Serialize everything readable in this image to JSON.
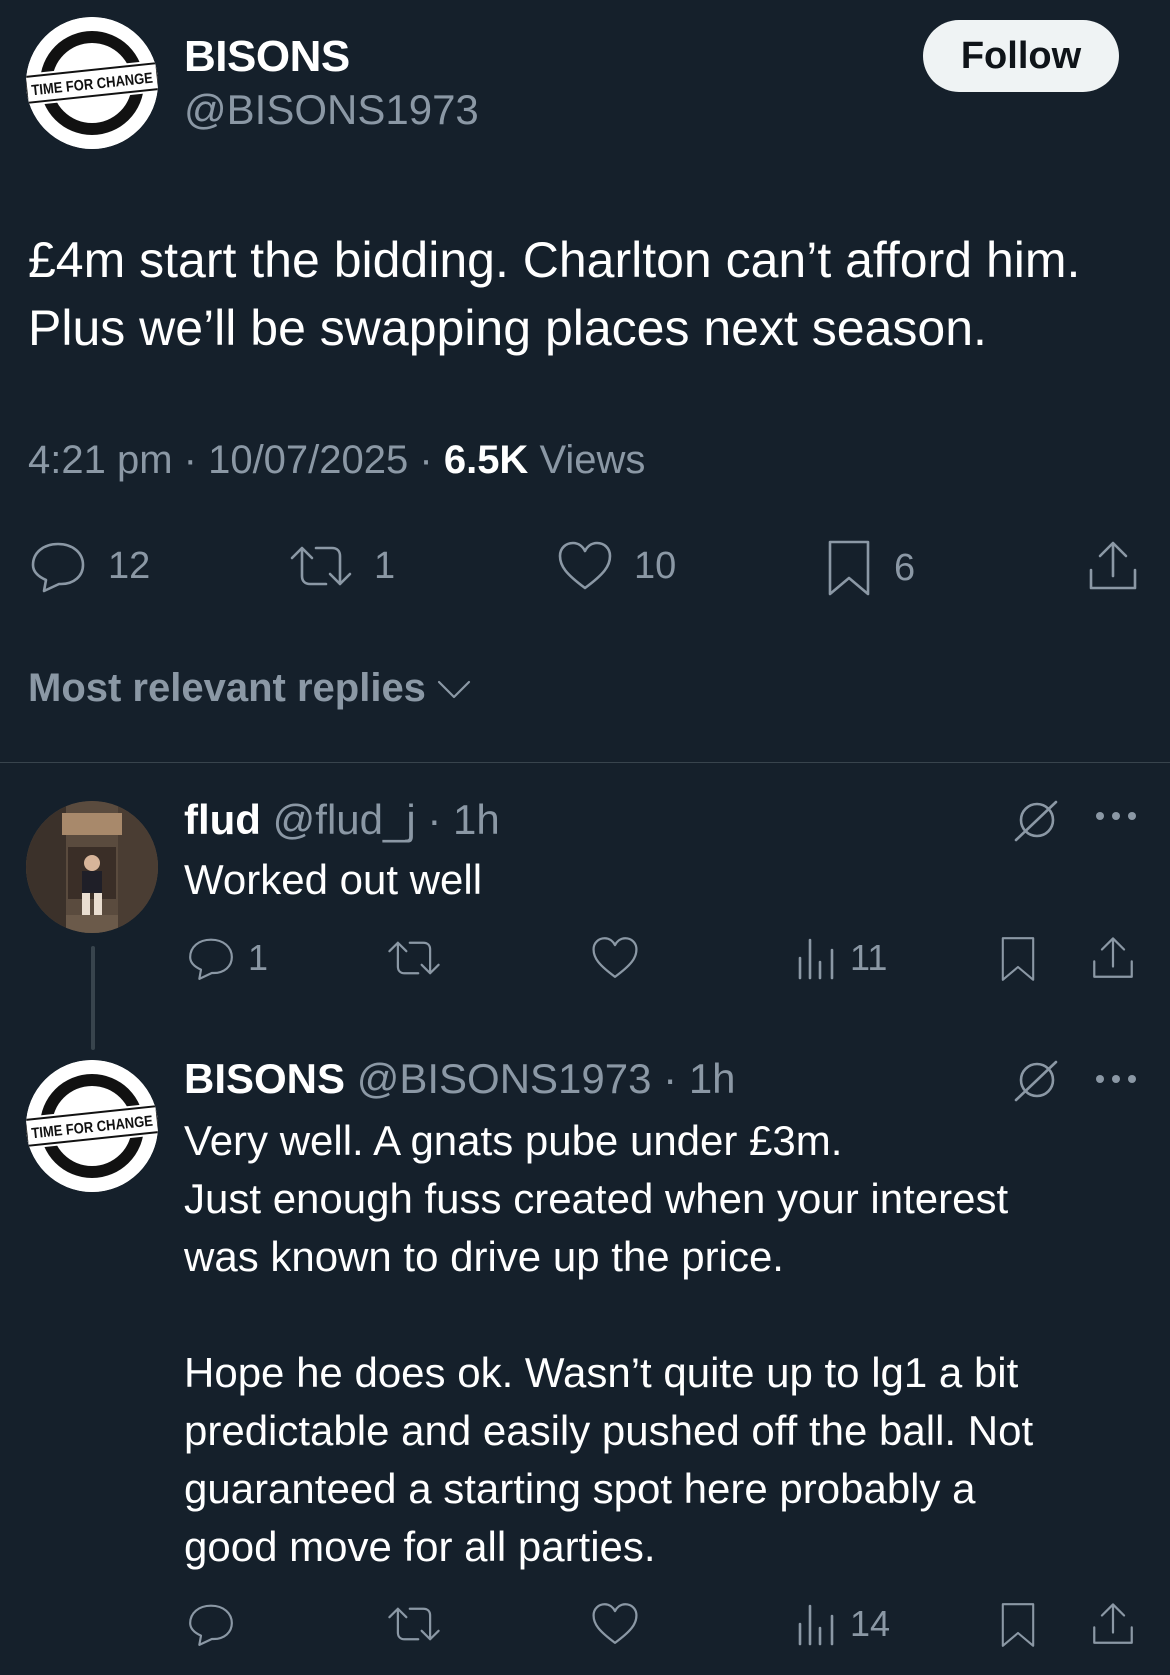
{
  "tweet": {
    "author": {
      "name": "BISONS",
      "handle": "@BISONS1973",
      "avatar_text": "TIME FOR CHANGE"
    },
    "follow_label": "Follow",
    "text_lines": [
      "£4m start the bidding. Charlton can’t afford him.",
      "Plus we’ll be swapping places next season."
    ],
    "time": "4:21 pm",
    "date": "10/07/2025",
    "views_count": "6.5K",
    "views_label": "Views",
    "stats": {
      "replies": "12",
      "reposts": "1",
      "likes": "10",
      "bookmarks": "6"
    },
    "icons": [
      "reply-icon",
      "repost-icon",
      "like-icon",
      "bookmark-icon",
      "share-icon"
    ]
  },
  "replies_filter": {
    "label": "Most relevant replies"
  },
  "replies": [
    {
      "name": "flud",
      "handle": "@flud_j",
      "time": "1h",
      "text": "Worked out well",
      "stats": {
        "replies": "1",
        "views": "11"
      }
    },
    {
      "name": "BISONS",
      "handle": "@BISONS1973",
      "time": "1h",
      "avatar_text": "TIME FOR CHANGE",
      "text_lines": [
        "Very well. A gnats pube under £3m.",
        "Just enough fuss created when your interest",
        "was known to drive up the price.",
        "",
        "Hope he does ok. Wasn’t quite up to lg1 a bit",
        "predictable and easily pushed off the ball. Not",
        "guaranteed a starting spot here probably a",
        "good move for all parties."
      ],
      "stats": {
        "views": "14"
      }
    }
  ],
  "colors": {
    "background": "#15202b",
    "muted": "#8b98a5",
    "divider": "#38444d",
    "follow_bg": "#eff3f4"
  }
}
